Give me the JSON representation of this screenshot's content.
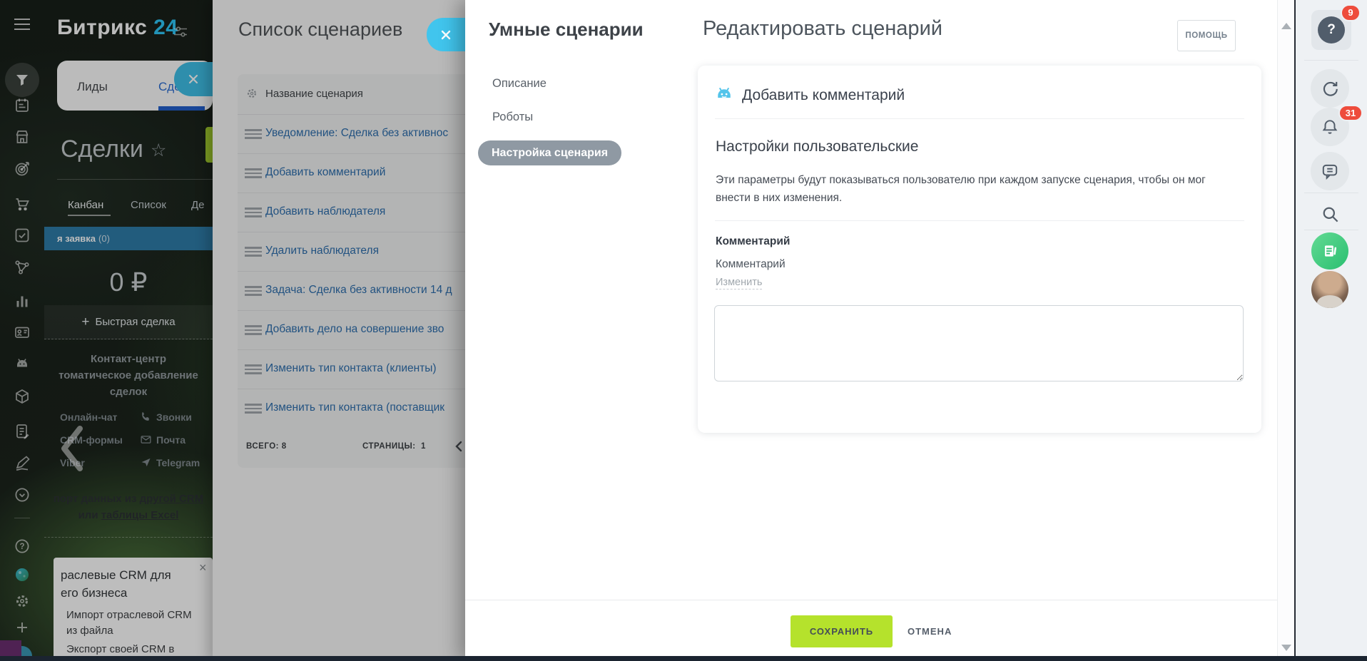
{
  "crm": {
    "logo_brand": "Битрикс",
    "logo_number": "24",
    "entity_tabs": [
      {
        "label": "Лиды"
      },
      {
        "label": "Сделки"
      }
    ],
    "page_title": "Сделки",
    "favorite_star": "☆",
    "view_tabs": [
      {
        "label": "Канбан"
      },
      {
        "label": "Список"
      },
      {
        "label": "Де"
      }
    ],
    "stage_label": "я заявка",
    "stage_count": "(0)",
    "amount": "0 ₽",
    "quick_deal_plus": "+",
    "quick_deal": "Быстрая сделка",
    "contact_center_line1": "Контакт-центр",
    "contact_center_line2": "томатическое добавление",
    "contact_center_line3": "сделок",
    "channels_left": [
      "Онлайн-чат",
      "CRM-формы",
      "Viber"
    ],
    "channels_right": [
      "Звонки",
      "Почта",
      "Telegram"
    ],
    "import_prefix": "порт данных из ",
    "import_link1": "другой CRM",
    "import_middle": "или ",
    "import_link2": "таблицы Excel",
    "promo_title_line1": "раслевые CRM для",
    "promo_title_line2": "его бизнеса",
    "promo_item1_line1": "Импорт отраслевой CRM",
    "promo_item1_line2": "из файла",
    "promo_item2": "Экспорт своей CRM в",
    "promo_close": "×"
  },
  "scenario_list": {
    "title": "Список сценариев",
    "column_header": "Название сценария",
    "rows": [
      {
        "label": "Уведомление: Сделка без активнос"
      },
      {
        "label": "Добавить комментарий"
      },
      {
        "label": "Добавить наблюдателя"
      },
      {
        "label": "Удалить наблюдателя"
      },
      {
        "label": "Задача: Сделка без активности 14 д"
      },
      {
        "label": "Добавить дело на совершение зво"
      },
      {
        "label": "Изменить тип контакта (клиенты)"
      },
      {
        "label": "Изменить тип контакта (поставщик"
      }
    ],
    "total_label": "ВСЕГО:",
    "total_value": "8",
    "pages_label": "СТРАНИЦЫ:",
    "pages_value": "1"
  },
  "slider": {
    "panel_title": "Умные сценарии",
    "nav": [
      {
        "label": "Описание"
      },
      {
        "label": "Роботы"
      },
      {
        "label": "Настройка сценария"
      }
    ],
    "title": "Редактировать сценарий",
    "help_button": "ПОМОЩЬ",
    "robot_card_title": "Добавить комментарий",
    "settings_title": "Настройки пользовательские",
    "settings_description": "Эти параметры будут показываться пользователю при каждом запуске сценария, чтобы он мог внести в них изменения.",
    "field_title": "Комментарий",
    "field_label": "Комментарий",
    "change_link": "Изменить",
    "comment_value": "",
    "save_button": "СОХРАНИТЬ",
    "cancel_button": "ОТМЕНА"
  },
  "right_rail": {
    "help_badge": "9",
    "notifications_badge": "31"
  },
  "icons": {
    "question_mark": "?"
  },
  "colors": {
    "accent_blue": "#2fc7f7",
    "save_green": "#b5e22c",
    "badge_red": "#ee4c3c",
    "close_teal": "#41c5ed",
    "stage_bar_blue": "#2e7ca9"
  }
}
